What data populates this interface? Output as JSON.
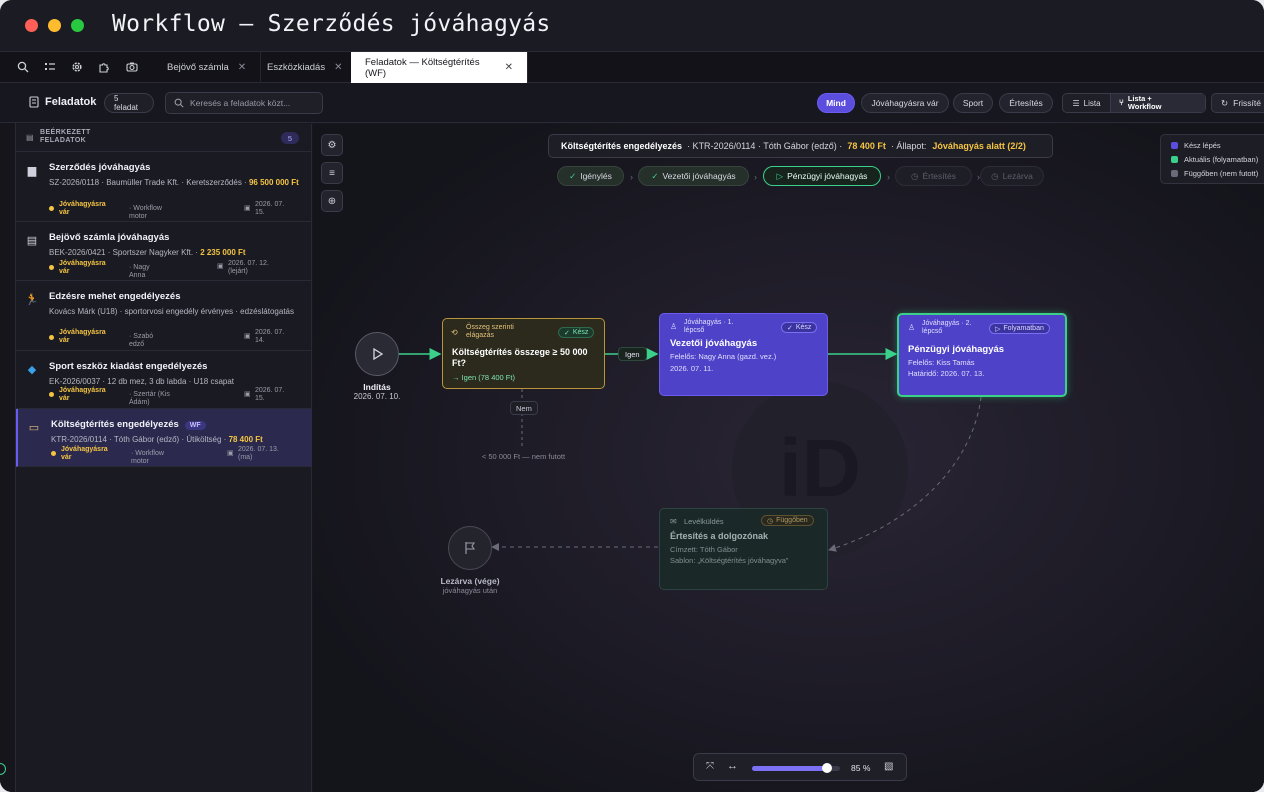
{
  "window": {
    "title": "Workflow — Szerződés jóváhagyás"
  },
  "tabs": [
    {
      "label": "Bejövő számla"
    },
    {
      "label": "Eszközkiadás"
    },
    {
      "label": "Feladatok — Költségtérítés (WF)"
    }
  ],
  "toolbar": {
    "title": "Feladatok",
    "count_badge": "5 feladat",
    "search_placeholder": "Keresés a feladatok közt...",
    "filters": [
      "Mind",
      "Jóváhagyásra vár",
      "Sport",
      "Értesítés"
    ],
    "view_list": "Lista",
    "view_list_workflow": "Lista + Workflow",
    "refresh": "Frissíté"
  },
  "sidebar": {
    "section_title": "BEÉRKEZETT FELADATOK",
    "section_count": "5",
    "tasks": [
      {
        "title": "Szerződés jóváhagyás",
        "meta": "SZ-2026/0118 · Baumüller Trade Kft. · Keretszerződés · ",
        "amount": "96 500 000 Ft",
        "status": "Jóváhagyásra vár",
        "assignee": "· Workflow motor",
        "due": "2026. 07. 15."
      },
      {
        "title": "Bejövő számla jóváhagyás",
        "meta": "BEK-2026/0421 · Sportszer Nagyker Kft. · ",
        "amount": "2 235 000 Ft",
        "status": "Jóváhagyásra vár",
        "assignee": "· Nagy Anna",
        "due": "2026. 07. 12. (lejárt)"
      },
      {
        "title": "Edzésre mehet engedélyezés",
        "meta": "Kovács Márk (U18) · sportorvosi engedély érvényes · edzéslátogatás",
        "amount": "",
        "status": "Jóváhagyásra vár",
        "assignee": "· Szabó edző",
        "due": "2026. 07. 14."
      },
      {
        "title": "Sport eszköz kiadást engedélyezés",
        "meta": "EK-2026/0037 · 12 db mez, 3 db labda · U18 csapat",
        "amount": "",
        "status": "Jóváhagyásra vár",
        "assignee": "· Szertár (Kis Ádám)",
        "due": "2026. 07. 15."
      },
      {
        "title": "Költségtérítés engedélyezés",
        "tag": "WF",
        "meta": "KTR-2026/0114 · Tóth Gábor (edző) · Útiköltség · ",
        "amount": "78 400 Ft",
        "status": "Jóváhagyásra vár",
        "assignee": "· Workflow motor",
        "due": "2026. 07. 13. (ma)"
      }
    ]
  },
  "infobar": {
    "title": "Költségtérítés engedélyezés",
    "ref": "· KTR-2026/0114 · Tóth Gábor (edző) ·",
    "amount": "78 400 Ft",
    "state_label": "· Állapot:",
    "state": "Jóváhagyás alatt (2/2)"
  },
  "steps": [
    "Igénylés",
    "Vezetői jóváhagyás",
    "Pénzügyi jóváhagyás",
    "Értesítés",
    "Lezárva"
  ],
  "legend": [
    "Kész lépés",
    "Aktuális (folyamatban)",
    "Függőben (nem futott)"
  ],
  "nodes": {
    "start": {
      "label": "Indítás",
      "date": "2026. 07. 10."
    },
    "branch": {
      "kind": "Összeg szerinti elágazás",
      "badge": "Kész",
      "title": "Költségtérítés összege ≥ 50 000 Ft?",
      "result": "→ Igen (78 400 Ft)"
    },
    "yes_label": "Igen",
    "no_label": "Nem",
    "no_note": "< 50 000 Ft — nem futott",
    "approve1": {
      "kind": "Jóváhagyás · 1. lépcső",
      "badge": "Kész",
      "title": "Vezetői jóváhagyás",
      "line1": "Felelős: Nagy Anna (gazd. vez.)",
      "line2": "2026. 07. 11."
    },
    "approve2": {
      "kind": "Jóváhagyás · 2. lépcső",
      "badge": "Folyamatban",
      "title": "Pénzügyi jóváhagyás",
      "line1": "Felelős: Kiss Tamás",
      "line2": "Határidő: 2026. 07. 13."
    },
    "notify": {
      "kind": "Levélküldés",
      "badge": "Függőben",
      "title": "Értesítés a dolgozónak",
      "line1": "Címzett: Tóth Gábor",
      "line2": "Sablon: „Költségtérítés jóváhagyva”"
    },
    "end": {
      "label": "Lezárva (vége)",
      "sub": "jóváhagyás után"
    }
  },
  "watermark": "iD",
  "zoom": {
    "level": 0.85,
    "label": "85 %"
  },
  "colors": {
    "accent": "#5b4dde",
    "done": "#3bd08a",
    "amount": "#f5c542",
    "branch_border": "#b8953a",
    "overdue": "#e86a6a"
  }
}
